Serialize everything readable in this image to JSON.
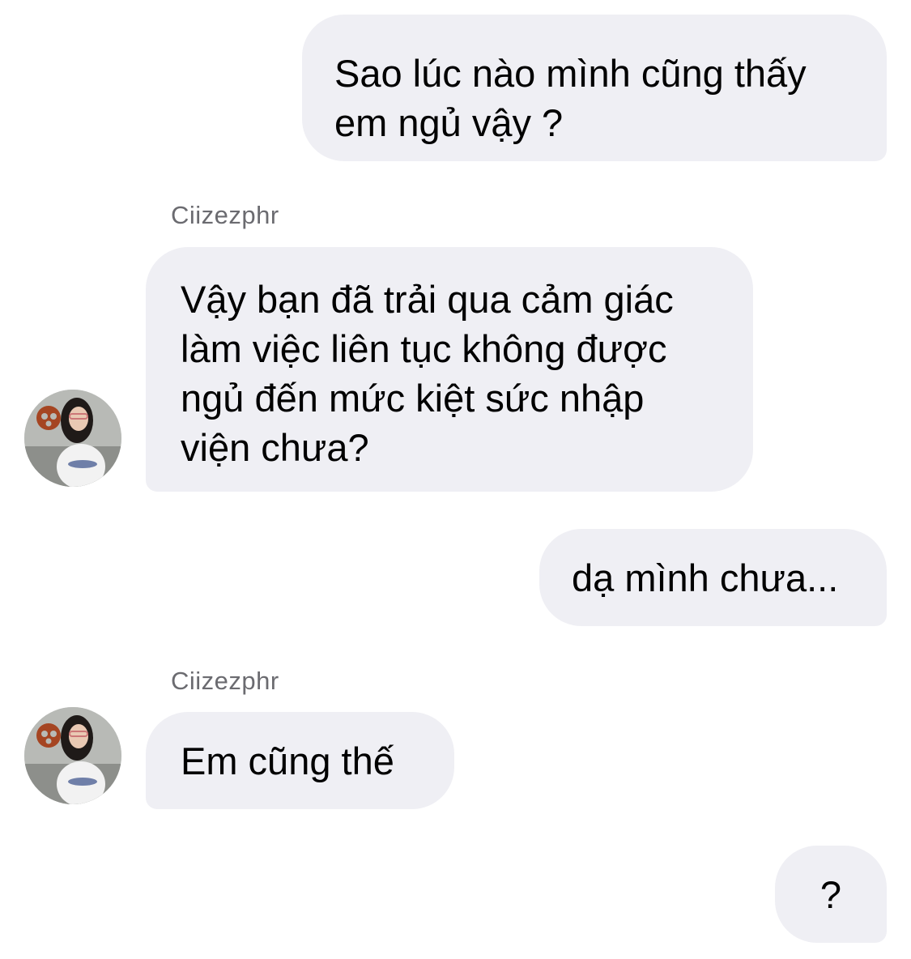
{
  "conversation": {
    "messages": [
      {
        "direction": "outgoing",
        "lines": [
          "Sao lúc nào mình cũng thấy",
          "em ngủ vậy ?"
        ]
      },
      {
        "direction": "incoming",
        "sender": "Ciizezphr",
        "lines": [
          "Vậy bạn đã trải qua cảm giác",
          "làm việc liên tục không được",
          "ngủ đến mức kiệt sức nhập",
          "viện chưa?"
        ]
      },
      {
        "direction": "outgoing",
        "lines": [
          "dạ mình chưa..."
        ]
      },
      {
        "direction": "incoming",
        "sender": "Ciizezphr",
        "lines": [
          "Em cũng thế"
        ]
      },
      {
        "direction": "outgoing",
        "lines": [
          "?"
        ]
      }
    ]
  },
  "colors": {
    "bubble_background": "#efeff4",
    "bubble_text": "#000000",
    "sender_name": "#6b6b70",
    "page_background": "#ffffff"
  },
  "icons": {
    "avatar": "contact-profile-photo"
  }
}
